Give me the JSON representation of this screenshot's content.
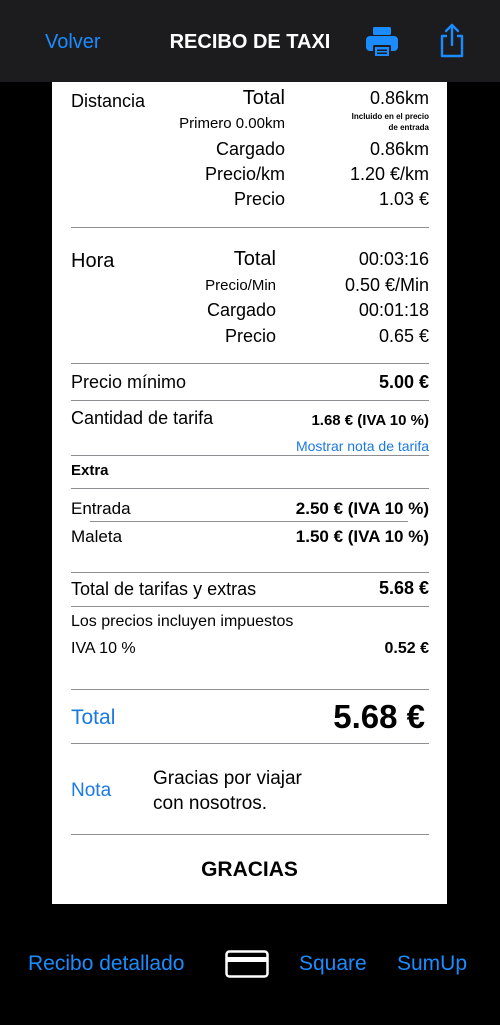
{
  "nav": {
    "back_label": "Volver",
    "title": "RECIBO DE TAXI",
    "print_icon": "printer-icon",
    "share_icon": "share-icon",
    "accent_color": "#1a8cff"
  },
  "distance": {
    "label": "Distancia",
    "total_label": "Total",
    "total_value": "0.86km",
    "first_label": "Primero 0.00km",
    "first_note_line1": "Incluido en el precio",
    "first_note_line2": "de entrada",
    "charged_label": "Cargado",
    "charged_value": "0.86km",
    "rate_label": "Precio/km",
    "rate_value": "1.20 €/km",
    "price_label": "Precio",
    "price_value": "1.03 €"
  },
  "time": {
    "label": "Hora",
    "total_label": "Total",
    "total_value": "00:03:16",
    "rate_label": "Precio/Min",
    "rate_value": "0.50 €/Min",
    "charged_label": "Cargado",
    "charged_value": "00:01:18",
    "price_label": "Precio",
    "price_value": "0.65 €"
  },
  "minimum": {
    "label": "Precio mínimo",
    "value": "5.00 €"
  },
  "fare": {
    "label": "Cantidad de tarifa",
    "value": "1.68 € (IVA 10 %)",
    "link": "Mostrar nota de tarifa"
  },
  "extras": {
    "heading": "Extra",
    "items": [
      {
        "label": "Entrada",
        "value": "2.50 € (IVA 10 %)"
      },
      {
        "label": "Maleta",
        "value": "1.50 € (IVA 10 %)"
      }
    ]
  },
  "totals": {
    "subtotal_label": "Total de tarifas y extras",
    "subtotal_value": "5.68 €",
    "tax_note": "Los precios incluyen impuestos",
    "vat_label": "IVA 10 %",
    "vat_value": "0.52 €",
    "total_label": "Total",
    "total_value": "5.68 €"
  },
  "note": {
    "label": "Nota",
    "line1": "Gracias por viajar",
    "line2": "con nosotros."
  },
  "footer_text": "GRACIAS",
  "bottom_bar": {
    "detailed_label": "Recibo detallado",
    "card_icon": "credit-card-icon",
    "square_label": "Square",
    "sumup_label": "SumUp"
  }
}
